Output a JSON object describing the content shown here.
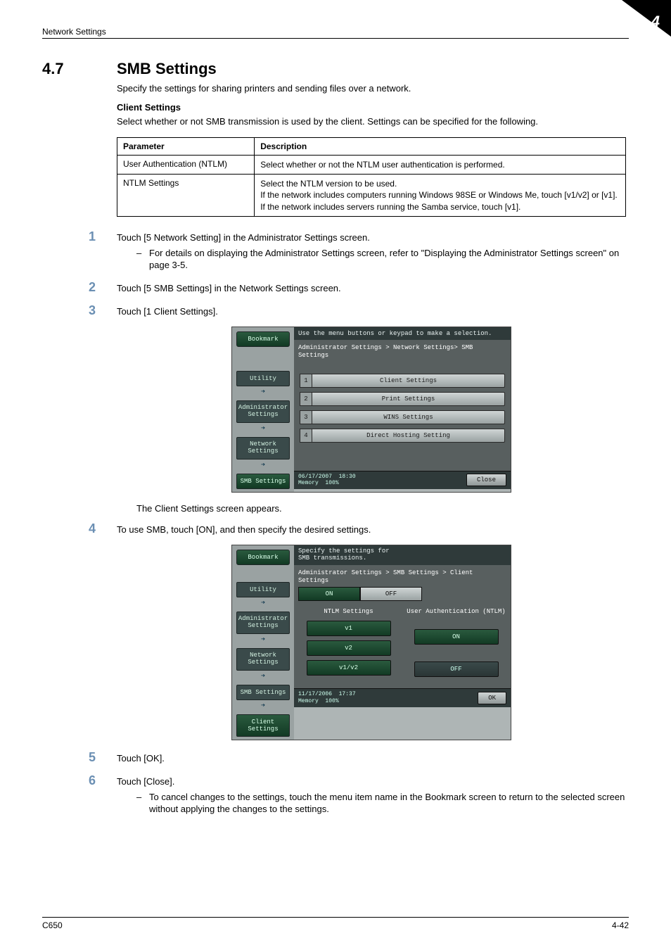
{
  "page": {
    "running_head": "Network Settings",
    "chapter_badge": "4",
    "footer_left": "C650",
    "footer_right": "4-42"
  },
  "section": {
    "number": "4.7",
    "title": "SMB Settings",
    "intro": "Specify the settings for sharing printers and sending files over a network.",
    "subhead": "Client Settings",
    "subintro": "Select whether or not SMB transmission is used by the client. Settings can be specified for the following."
  },
  "table": {
    "headers": {
      "param": "Parameter",
      "desc": "Description"
    },
    "rows": [
      {
        "param": "User Authentication (NTLM)",
        "desc": "Select whether or not the NTLM user authentication is performed."
      },
      {
        "param": "NTLM Settings",
        "desc": "Select the NTLM version to be used.\nIf the network includes computers running Windows 98SE or Windows Me, touch [v1/v2] or [v1].\nIf the network includes servers running the Samba service, touch [v1]."
      }
    ]
  },
  "steps": [
    {
      "n": "1",
      "text": "Touch [5 Network Setting] in the Administrator Settings screen.",
      "bullets": [
        "For details on displaying the Administrator Settings screen, refer to \"Displaying the Administrator Settings screen\" on page 3-5."
      ]
    },
    {
      "n": "2",
      "text": "Touch [5 SMB Settings] in the Network Settings screen."
    },
    {
      "n": "3",
      "text": "Touch [1 Client Settings]."
    }
  ],
  "after_scr1": "The Client Settings screen appears.",
  "step4": {
    "n": "4",
    "text": "To use SMB, touch [ON], and then specify the desired settings."
  },
  "tail_steps": [
    {
      "n": "5",
      "text": "Touch [OK]."
    },
    {
      "n": "6",
      "text": "Touch [Close].",
      "bullets": [
        "To cancel changes to the settings, touch the menu item name in the Bookmark screen to return to the selected screen without applying the changes to the settings."
      ]
    }
  ],
  "screen1": {
    "topmsg": "Use the menu buttons or keypad to make a selection.",
    "breadcrumb": "Administrator Settings > Network Settings> SMB Settings",
    "sidebar": {
      "bookmark": "Bookmark",
      "items": [
        "Utility",
        "Administrator Settings",
        "Network Settings",
        "SMB Settings"
      ]
    },
    "menu": [
      {
        "n": "1",
        "label": "Client Settings"
      },
      {
        "n": "2",
        "label": "Print Settings"
      },
      {
        "n": "3",
        "label": "WINS Settings"
      },
      {
        "n": "4",
        "label": "Direct Hosting Setting"
      }
    ],
    "status": {
      "date": "06/17/2007",
      "time": "18:30",
      "mem_label": "Memory",
      "mem": "100%",
      "close": "Close"
    }
  },
  "screen2": {
    "topmsg1": "Specify the settings for",
    "topmsg2": "SMB transmissions.",
    "breadcrumb": "Administrator Settings > SMB Settings > Client Settings",
    "sidebar": {
      "bookmark": "Bookmark",
      "items": [
        "Utility",
        "Administrator Settings",
        "Network Settings",
        "SMB Settings",
        "Client Settings"
      ]
    },
    "onoff": {
      "on": "ON",
      "off": "OFF"
    },
    "left_header": "NTLM Settings",
    "right_header": "User Authentication (NTLM)",
    "ntlm_opts": [
      "v1",
      "v2",
      "v1/v2"
    ],
    "auth_opts": {
      "on": "ON",
      "off": "OFF"
    },
    "status": {
      "date": "11/17/2006",
      "time": "17:37",
      "mem_label": "Memory",
      "mem": "100%",
      "ok": "OK"
    }
  }
}
